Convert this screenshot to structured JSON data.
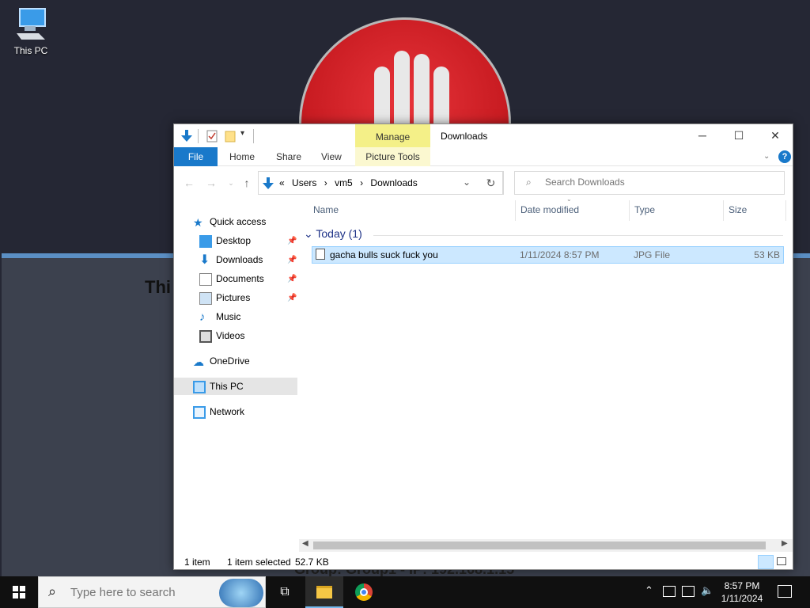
{
  "desktop": {
    "icon_label": "This PC",
    "panel_title": "Thi",
    "panel_footer": "Group: Group1 - IP: 192.168.1.15"
  },
  "window": {
    "title": "Downloads",
    "manage_label": "Manage",
    "picture_tools_label": "Picture Tools",
    "ribbon_tabs": [
      "File",
      "Home",
      "Share",
      "View"
    ],
    "address": {
      "prefix": "«",
      "crumbs": [
        "Users",
        "vm5",
        "Downloads"
      ]
    },
    "search_placeholder": "Search Downloads"
  },
  "nav": {
    "quick_access": "Quick access",
    "items": [
      "Desktop",
      "Downloads",
      "Documents",
      "Pictures",
      "Music",
      "Videos"
    ],
    "onedrive": "OneDrive",
    "this_pc": "This PC",
    "network": "Network"
  },
  "columns": [
    "Name",
    "Date modified",
    "Type",
    "Size"
  ],
  "group_header": "Today (1)",
  "files": [
    {
      "name": "gacha bulls suck fuck you",
      "date": "1/11/2024 8:57 PM",
      "type": "JPG File",
      "size": "53 KB"
    }
  ],
  "status": {
    "count": "1 item",
    "selected": "1 item selected",
    "size": "52.7 KB"
  },
  "taskbar": {
    "search_placeholder": "Type here to search",
    "time": "8:57 PM",
    "date": "1/11/2024"
  },
  "colors": {
    "accent": "#1979ca",
    "selection": "#cce8ff",
    "manage": "#f4f088"
  }
}
